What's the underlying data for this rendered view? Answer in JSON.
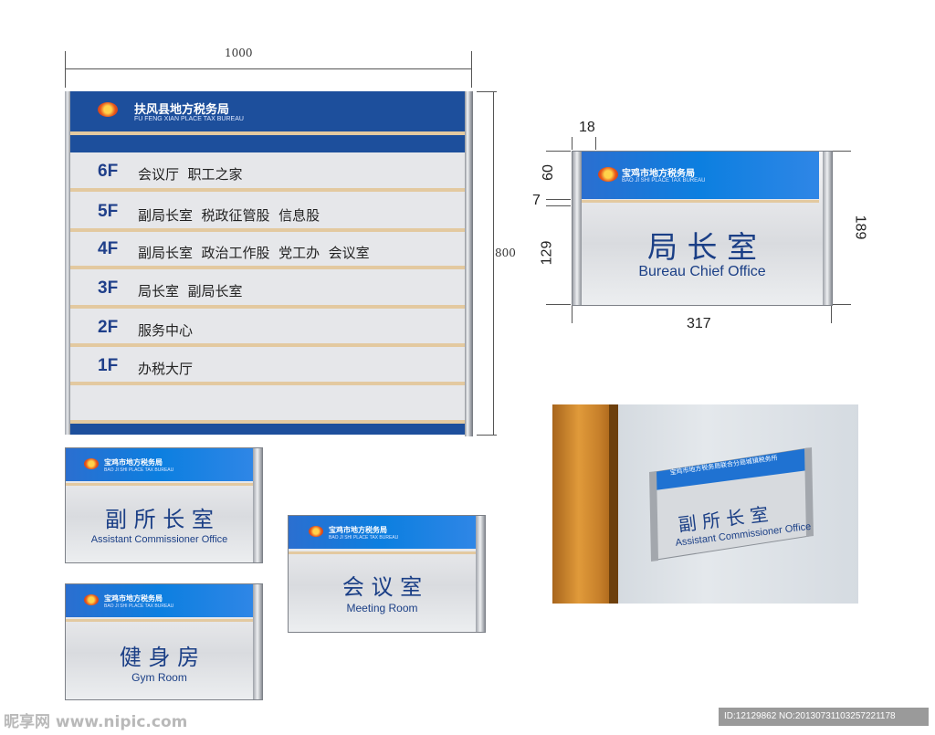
{
  "dimensions": {
    "directory_width": "1000",
    "directory_height": "800",
    "sign_dim_top": "18",
    "sign_dim_head": "60",
    "sign_dim_gap": "7",
    "sign_dim_body": "129",
    "sign_dim_height": "189",
    "sign_dim_width": "317"
  },
  "directory": {
    "org_cn": "扶风县地方税务局",
    "org_en": "FU FENG XIAN PLACE TAX BUREAU",
    "floors": [
      {
        "floor": "6F",
        "rooms": "会议厅  职工之家"
      },
      {
        "floor": "5F",
        "rooms": "副局长室  税政征管股  信息股"
      },
      {
        "floor": "4F",
        "rooms": "副局长室  政治工作股  党工办  会议室"
      },
      {
        "floor": "3F",
        "rooms": "局长室  副局长室"
      },
      {
        "floor": "2F",
        "rooms": "服务中心"
      },
      {
        "floor": "1F",
        "rooms": "办税大厅"
      }
    ]
  },
  "signs": {
    "org_cn": "宝鸡市地方税务局",
    "org_en": "BAO JI SHI PLACE TAX BUREAU",
    "chief": {
      "cn": "局 长 室",
      "en": "Bureau Chief Office"
    },
    "assistant": {
      "cn": "副 所 长 室",
      "en": "Assistant Commissioner Office"
    },
    "meeting": {
      "cn": "会 议 室",
      "en": "Meeting Room"
    },
    "gym": {
      "cn": "健 身 房",
      "en": "Gym Room"
    }
  },
  "photo": {
    "org_cn": "宝鸡市地方税务局联合分局城镇税务所",
    "sign_cn": "副 所 长 室",
    "sign_en": "Assistant Commissioner Office"
  },
  "watermark": {
    "brand": "昵享网 www.nipic.com",
    "id_text": "ID:12129862 NO:20130731103257221178"
  },
  "colors": {
    "brand_blue": "#1d4f9c",
    "sign_blue": "#0c7fe0",
    "text_blue": "#1b3f86",
    "accent_tan": "#e3c9a0"
  }
}
